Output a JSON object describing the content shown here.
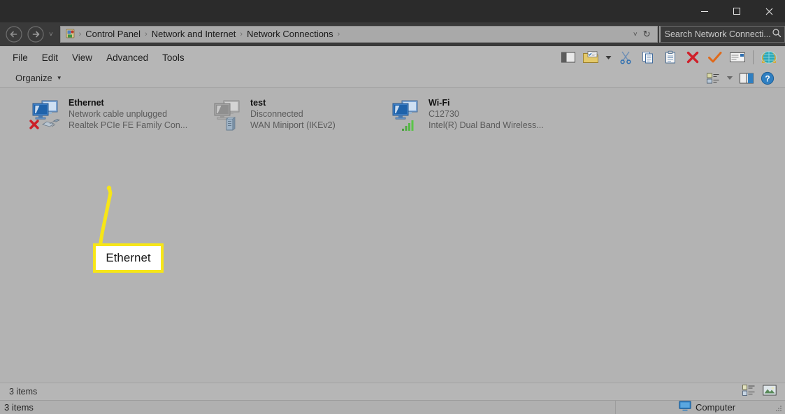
{
  "window": {
    "controls": {
      "minimize": "minimize-button",
      "maximize": "maximize-button",
      "close": "close-button"
    }
  },
  "address_bar": {
    "back": "back-button",
    "forward": "forward-button",
    "history_caret": "˅",
    "breadcrumbs": [
      {
        "label": "Control Panel"
      },
      {
        "label": "Network and Internet"
      },
      {
        "label": "Network Connections"
      }
    ],
    "separator": "›",
    "dropdown_caret": "˅",
    "refresh": "↻",
    "search": {
      "placeholder": "Search Network Connecti...",
      "icon": "search-icon"
    }
  },
  "menu": {
    "items": [
      {
        "label": "File"
      },
      {
        "label": "Edit"
      },
      {
        "label": "View"
      },
      {
        "label": "Advanced"
      },
      {
        "label": "Tools"
      }
    ],
    "toolbar_icons": [
      {
        "name": "layout-pane-icon"
      },
      {
        "name": "folder-options-icon"
      },
      {
        "name": "cut-scissors-icon"
      },
      {
        "name": "copy-icon"
      },
      {
        "name": "paste-icon"
      },
      {
        "name": "delete-red-x-icon"
      },
      {
        "name": "confirm-checkmark-icon"
      },
      {
        "name": "rename-icon"
      },
      {
        "name": "globe-icon"
      }
    ]
  },
  "command_bar": {
    "organize": {
      "label": "Organize",
      "caret": "▼"
    },
    "right_icons": [
      {
        "name": "change-view-icon"
      },
      {
        "name": "view-dropdown-caret"
      },
      {
        "name": "preview-pane-icon"
      },
      {
        "name": "help-icon"
      }
    ]
  },
  "connections": [
    {
      "name": "Ethernet",
      "status": "Network cable unplugged",
      "device": "Realtek PCIe FE Family Con...",
      "icon": "network-adapter-icon",
      "badge": "red-x-unplugged-badge",
      "state": "disconnected"
    },
    {
      "name": "test",
      "status": "Disconnected",
      "device": "WAN Miniport (IKEv2)",
      "icon": "vpn-connection-icon",
      "badge": "vpn-server-badge",
      "state": "disconnected"
    },
    {
      "name": "Wi-Fi",
      "status": "C12730",
      "device": "Intel(R) Dual Band Wireless...",
      "icon": "wireless-adapter-icon",
      "badge": "signal-bars-badge",
      "state": "connected"
    }
  ],
  "annotation": {
    "label": "Ethernet",
    "border_color": "#f7e617",
    "background_color": "#ffffff"
  },
  "status_bar": {
    "items_count": "3 items",
    "view_icons": [
      {
        "name": "details-view-icon"
      },
      {
        "name": "large-icons-view-icon"
      }
    ]
  },
  "taskbar_status": {
    "items_count": "3 items",
    "computer_label": "Computer",
    "computer_icon": "computer-monitor-icon"
  },
  "colors": {
    "titlebar": "#2b2b2b",
    "addressbar": "#3a3a3a",
    "chrome": "#b6b6b6",
    "content": "#b3b3b3",
    "accent_yellow": "#f7e617"
  }
}
